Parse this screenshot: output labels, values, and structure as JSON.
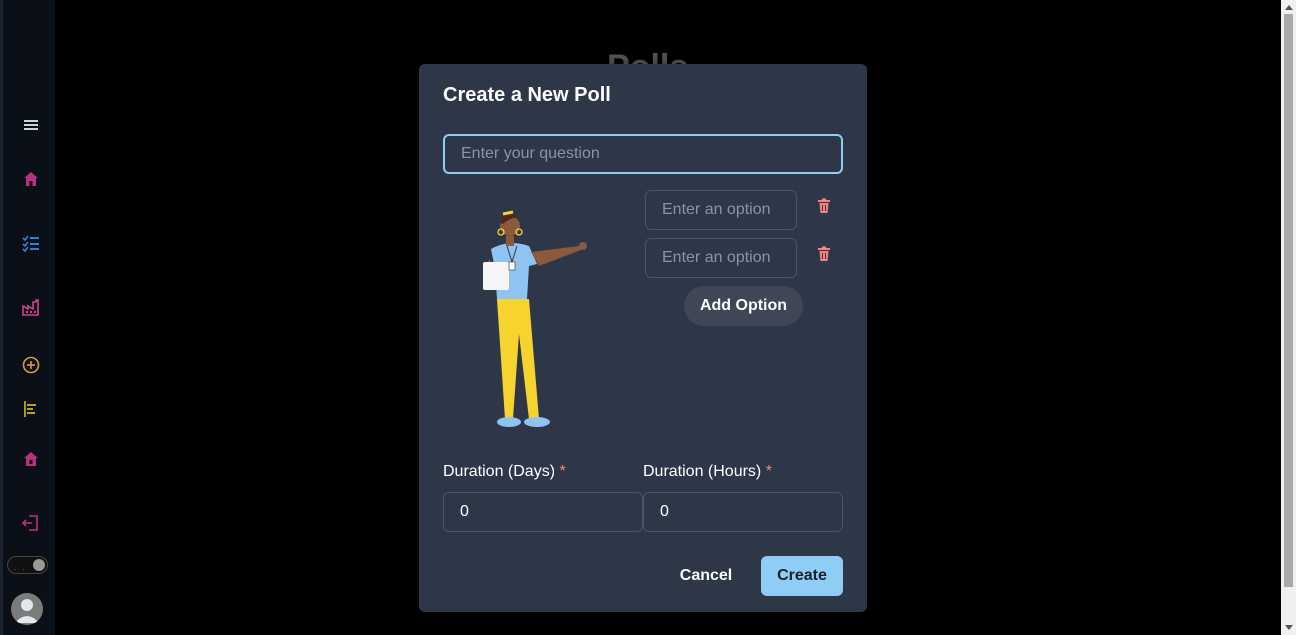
{
  "background": {
    "page_title": "Polls"
  },
  "sidebar": {
    "icons": [
      "menu-icon",
      "home-icon",
      "checklist-icon",
      "factory-icon",
      "add-circle-icon",
      "align-left-icon",
      "house-icon",
      "logout-icon"
    ]
  },
  "modal": {
    "title": "Create a New Poll",
    "question_placeholder": "Enter your question",
    "options": [
      {
        "placeholder": "Enter an option",
        "value": ""
      },
      {
        "placeholder": "Enter an option",
        "value": ""
      }
    ],
    "add_option_label": "Add Option",
    "duration_days_label": "Duration (Days)",
    "duration_hours_label": "Duration (Hours)",
    "required_marker": "*",
    "duration_days_value": "0",
    "duration_hours_value": "0",
    "cancel_label": "Cancel",
    "create_label": "Create"
  },
  "colors": {
    "modal_bg": "#2d3748",
    "accent": "#90cdf4",
    "required": "#fc8181"
  }
}
